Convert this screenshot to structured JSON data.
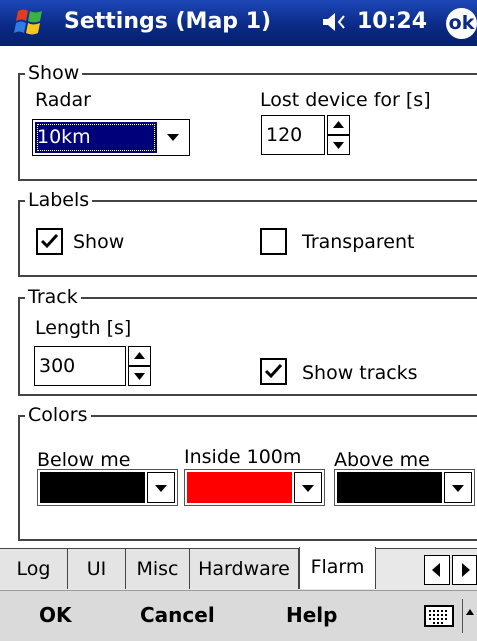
{
  "window": {
    "title": "Settings (Map 1)",
    "time": "10:24",
    "ok_label": "ok"
  },
  "show": {
    "legend": "Show",
    "radar_label": "Radar",
    "radar_value": "10km",
    "lost_label": "Lost device for [s]",
    "lost_value": "120"
  },
  "labels": {
    "legend": "Labels",
    "show_label": "Show",
    "show_checked": true,
    "transparent_label": "Transparent",
    "transparent_checked": false
  },
  "track": {
    "legend": "Track",
    "length_label": "Length [s]",
    "length_value": "300",
    "show_tracks_label": "Show tracks",
    "show_tracks_checked": true
  },
  "colors": {
    "legend": "Colors",
    "below_label": "Below me",
    "below_color": "#000000",
    "inside_label": "Inside 100m",
    "inside_color": "#ff0000",
    "above_label": "Above me",
    "above_color": "#000000"
  },
  "tabs": [
    {
      "label": "Log"
    },
    {
      "label": "UI"
    },
    {
      "label": "Misc"
    },
    {
      "label": "Hardware"
    },
    {
      "label": "Flarm"
    }
  ],
  "active_tab": "Flarm",
  "menu": {
    "ok": "OK",
    "cancel": "Cancel",
    "help": "Help"
  },
  "theme": {
    "titlebar": "#0b2a86",
    "selection": "#00007b"
  }
}
